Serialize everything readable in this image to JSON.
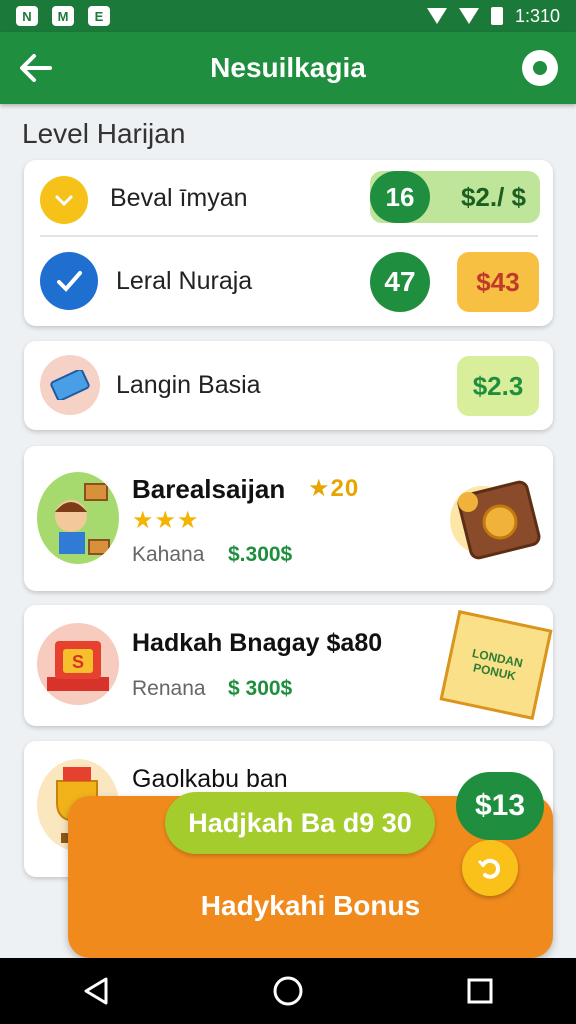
{
  "status": {
    "icons": [
      "N",
      "M",
      "E"
    ],
    "time": "1:310"
  },
  "appbar": {
    "title": "Nesuilkagia",
    "back_icon": "arrow-left-icon",
    "action_icon": "location-pin-icon"
  },
  "section_title": "Level Harijan",
  "card1": {
    "row1": {
      "icon": "chevron-down-icon",
      "label": "Beval īmyan",
      "count": "16",
      "price": "$2./ $"
    },
    "row2": {
      "icon": "checkmark-icon",
      "label": "Leral Nuraja",
      "count": "47",
      "price": "$43"
    }
  },
  "card2": {
    "icon": "ticket-icon",
    "label": "Langin Basia",
    "price": "$2.3"
  },
  "card3": {
    "title": "Barealsaijan",
    "badge": "★20",
    "stars": "★★★",
    "sub": "Kahana",
    "money": "$.300$",
    "art_left": "kid-character-icon",
    "art_right": "safe-coin-icon"
  },
  "card4": {
    "title": "Hadkah Bnagay $a80",
    "sub": "Renana",
    "money": "$ 300$",
    "art_left": "treasure-chest-icon",
    "art_right": "bonus-ticket-icon",
    "ticket_text": "LONDAN PONUK"
  },
  "card5": {
    "title": "Gaolkabu ban",
    "art_left": "trophy-icon",
    "bubble": "$13"
  },
  "bottom": {
    "pill": "Hadjkah Ba d9 30",
    "main": "Hadykahi Bonus",
    "refresh_icon": "refresh-icon"
  },
  "colors": {
    "primary": "#1f8f3f",
    "accent": "#f08a1c",
    "lime": "#a3cc2c"
  }
}
